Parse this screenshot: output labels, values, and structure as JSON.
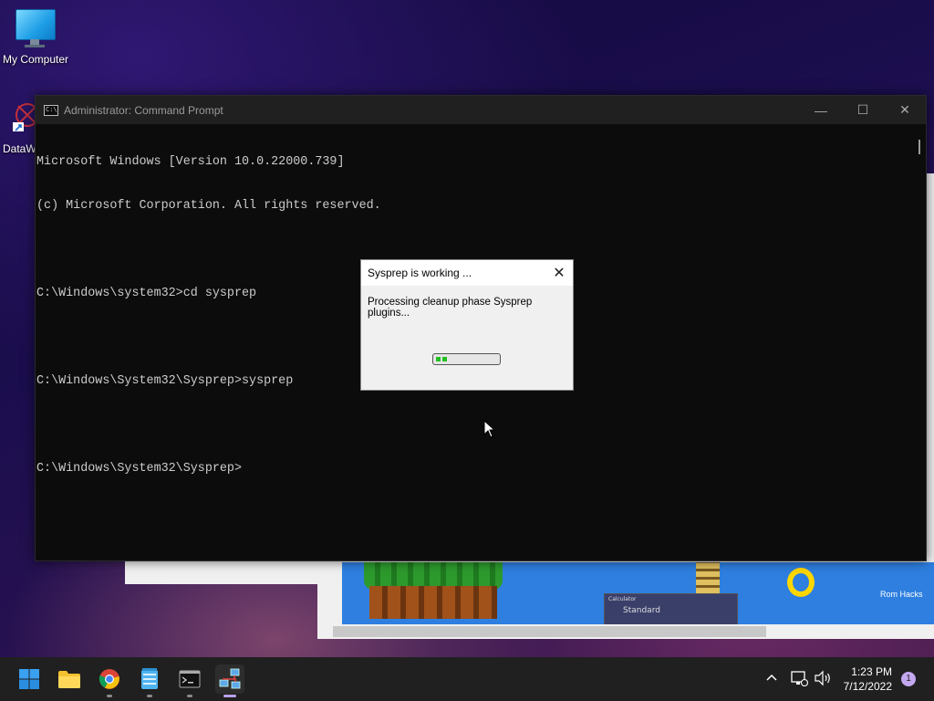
{
  "desktop": {
    "icons": [
      {
        "label": "My Computer"
      },
      {
        "label": "DataW"
      }
    ]
  },
  "background_window": {
    "game_label": "Rom Hacks",
    "calc_title": "Calculator",
    "calc_mode": "Standard"
  },
  "cmd": {
    "title": "Administrator: Command Prompt",
    "icon_glyph": "C:\\",
    "lines": [
      "Microsoft Windows [Version 10.0.22000.739]",
      "(c) Microsoft Corporation. All rights reserved.",
      "",
      "C:\\Windows\\system32>cd sysprep",
      "",
      "C:\\Windows\\System32\\Sysprep>sysprep",
      "",
      "C:\\Windows\\System32\\Sysprep>"
    ],
    "minimize_glyph": "—",
    "maximize_glyph": "☐",
    "close_glyph": "✕"
  },
  "dialog": {
    "title": "Sysprep is working ...",
    "message": "Processing cleanup phase Sysprep plugins...",
    "progress_fraction": 0.2,
    "close_glyph": "✕"
  },
  "taskbar": {
    "apps": [
      {
        "name": "start",
        "icon": "windows-logo-icon"
      },
      {
        "name": "file-explorer",
        "icon": "folder-icon"
      },
      {
        "name": "chrome",
        "icon": "chrome-icon"
      },
      {
        "name": "notepad",
        "icon": "notepad-icon"
      },
      {
        "name": "command-prompt",
        "icon": "terminal-icon"
      },
      {
        "name": "network-app",
        "icon": "network-icon"
      }
    ],
    "tray": {
      "chevron": "^",
      "time": "1:23 PM",
      "date": "7/12/2022",
      "notification_count": "1"
    }
  },
  "colors": {
    "accent": "#b9a3e8",
    "progress": "#22c022",
    "console_bg": "#0c0c0c",
    "console_text": "#cccccc"
  }
}
